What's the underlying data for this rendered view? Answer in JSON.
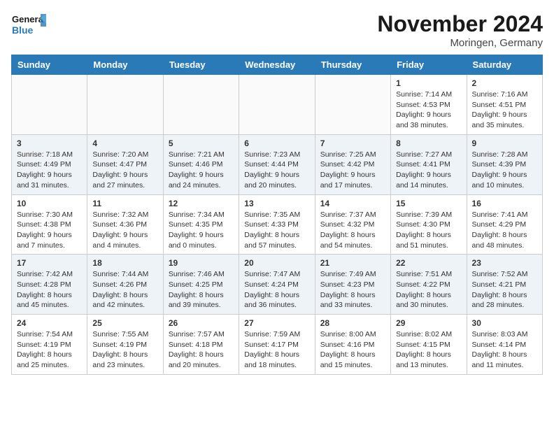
{
  "logo": {
    "line1": "General",
    "line2": "Blue"
  },
  "title": "November 2024",
  "location": "Moringen, Germany",
  "weekdays": [
    "Sunday",
    "Monday",
    "Tuesday",
    "Wednesday",
    "Thursday",
    "Friday",
    "Saturday"
  ],
  "weeks": [
    [
      {
        "day": "",
        "info": ""
      },
      {
        "day": "",
        "info": ""
      },
      {
        "day": "",
        "info": ""
      },
      {
        "day": "",
        "info": ""
      },
      {
        "day": "",
        "info": ""
      },
      {
        "day": "1",
        "info": "Sunrise: 7:14 AM\nSunset: 4:53 PM\nDaylight: 9 hours\nand 38 minutes."
      },
      {
        "day": "2",
        "info": "Sunrise: 7:16 AM\nSunset: 4:51 PM\nDaylight: 9 hours\nand 35 minutes."
      }
    ],
    [
      {
        "day": "3",
        "info": "Sunrise: 7:18 AM\nSunset: 4:49 PM\nDaylight: 9 hours\nand 31 minutes."
      },
      {
        "day": "4",
        "info": "Sunrise: 7:20 AM\nSunset: 4:47 PM\nDaylight: 9 hours\nand 27 minutes."
      },
      {
        "day": "5",
        "info": "Sunrise: 7:21 AM\nSunset: 4:46 PM\nDaylight: 9 hours\nand 24 minutes."
      },
      {
        "day": "6",
        "info": "Sunrise: 7:23 AM\nSunset: 4:44 PM\nDaylight: 9 hours\nand 20 minutes."
      },
      {
        "day": "7",
        "info": "Sunrise: 7:25 AM\nSunset: 4:42 PM\nDaylight: 9 hours\nand 17 minutes."
      },
      {
        "day": "8",
        "info": "Sunrise: 7:27 AM\nSunset: 4:41 PM\nDaylight: 9 hours\nand 14 minutes."
      },
      {
        "day": "9",
        "info": "Sunrise: 7:28 AM\nSunset: 4:39 PM\nDaylight: 9 hours\nand 10 minutes."
      }
    ],
    [
      {
        "day": "10",
        "info": "Sunrise: 7:30 AM\nSunset: 4:38 PM\nDaylight: 9 hours\nand 7 minutes."
      },
      {
        "day": "11",
        "info": "Sunrise: 7:32 AM\nSunset: 4:36 PM\nDaylight: 9 hours\nand 4 minutes."
      },
      {
        "day": "12",
        "info": "Sunrise: 7:34 AM\nSunset: 4:35 PM\nDaylight: 9 hours\nand 0 minutes."
      },
      {
        "day": "13",
        "info": "Sunrise: 7:35 AM\nSunset: 4:33 PM\nDaylight: 8 hours\nand 57 minutes."
      },
      {
        "day": "14",
        "info": "Sunrise: 7:37 AM\nSunset: 4:32 PM\nDaylight: 8 hours\nand 54 minutes."
      },
      {
        "day": "15",
        "info": "Sunrise: 7:39 AM\nSunset: 4:30 PM\nDaylight: 8 hours\nand 51 minutes."
      },
      {
        "day": "16",
        "info": "Sunrise: 7:41 AM\nSunset: 4:29 PM\nDaylight: 8 hours\nand 48 minutes."
      }
    ],
    [
      {
        "day": "17",
        "info": "Sunrise: 7:42 AM\nSunset: 4:28 PM\nDaylight: 8 hours\nand 45 minutes."
      },
      {
        "day": "18",
        "info": "Sunrise: 7:44 AM\nSunset: 4:26 PM\nDaylight: 8 hours\nand 42 minutes."
      },
      {
        "day": "19",
        "info": "Sunrise: 7:46 AM\nSunset: 4:25 PM\nDaylight: 8 hours\nand 39 minutes."
      },
      {
        "day": "20",
        "info": "Sunrise: 7:47 AM\nSunset: 4:24 PM\nDaylight: 8 hours\nand 36 minutes."
      },
      {
        "day": "21",
        "info": "Sunrise: 7:49 AM\nSunset: 4:23 PM\nDaylight: 8 hours\nand 33 minutes."
      },
      {
        "day": "22",
        "info": "Sunrise: 7:51 AM\nSunset: 4:22 PM\nDaylight: 8 hours\nand 30 minutes."
      },
      {
        "day": "23",
        "info": "Sunrise: 7:52 AM\nSunset: 4:21 PM\nDaylight: 8 hours\nand 28 minutes."
      }
    ],
    [
      {
        "day": "24",
        "info": "Sunrise: 7:54 AM\nSunset: 4:19 PM\nDaylight: 8 hours\nand 25 minutes."
      },
      {
        "day": "25",
        "info": "Sunrise: 7:55 AM\nSunset: 4:19 PM\nDaylight: 8 hours\nand 23 minutes."
      },
      {
        "day": "26",
        "info": "Sunrise: 7:57 AM\nSunset: 4:18 PM\nDaylight: 8 hours\nand 20 minutes."
      },
      {
        "day": "27",
        "info": "Sunrise: 7:59 AM\nSunset: 4:17 PM\nDaylight: 8 hours\nand 18 minutes."
      },
      {
        "day": "28",
        "info": "Sunrise: 8:00 AM\nSunset: 4:16 PM\nDaylight: 8 hours\nand 15 minutes."
      },
      {
        "day": "29",
        "info": "Sunrise: 8:02 AM\nSunset: 4:15 PM\nDaylight: 8 hours\nand 13 minutes."
      },
      {
        "day": "30",
        "info": "Sunrise: 8:03 AM\nSunset: 4:14 PM\nDaylight: 8 hours\nand 11 minutes."
      }
    ]
  ]
}
